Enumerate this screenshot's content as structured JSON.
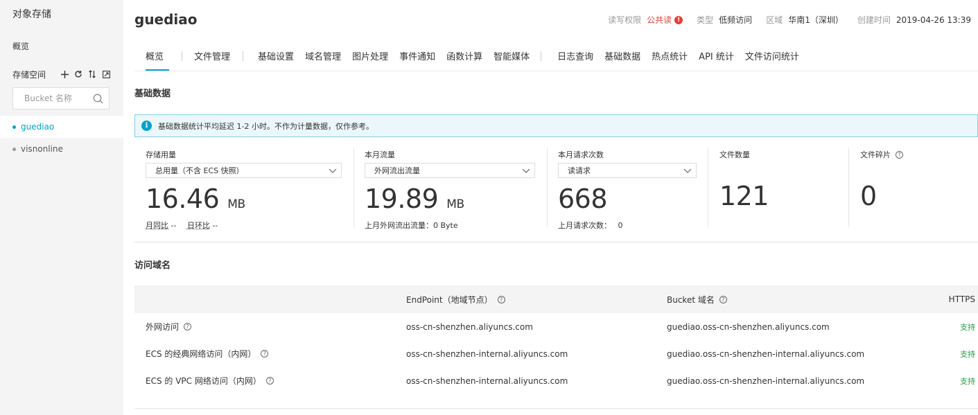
{
  "sidebar": {
    "title": "对象存储",
    "overview": "概览",
    "storage_space": "存储空间",
    "search_placeholder": "Bucket 名称",
    "buckets": [
      {
        "name": "guediao",
        "active": true
      },
      {
        "name": "visnonline",
        "active": false
      }
    ]
  },
  "header": {
    "bucket_name": "guediao",
    "acl_label": "读写权限",
    "acl_value": "公共读",
    "type_label": "类型",
    "type_value": "低频访问",
    "region_label": "区域",
    "region_value": "华南1（深圳）",
    "created_label": "创建时间",
    "created_value": "2019-04-26 13:39"
  },
  "tabs": [
    "概览",
    "文件管理",
    "基础设置",
    "域名管理",
    "图片处理",
    "事件通知",
    "函数计算",
    "智能媒体",
    "日志查询",
    "基础数据",
    "热点统计",
    "API 统计",
    "文件访问统计"
  ],
  "basic": {
    "title": "基础数据",
    "notice": "基础数据统计平均延迟 1-2 小时。不作为计量数据，仅作参考。",
    "stats": {
      "storage": {
        "label": "存储用量",
        "select": "总用量（不含 ECS 快照）",
        "value": "16.46",
        "unit": "MB",
        "yoy_label": "月同比",
        "yoy_value": "--",
        "mom_label": "日环比",
        "mom_value": "--"
      },
      "traffic": {
        "label": "本月流量",
        "select": "外网流出流量",
        "value": "19.89",
        "unit": "MB",
        "foot": "上月外网流出流量：0 Byte"
      },
      "requests": {
        "label": "本月请求次数",
        "select": "读请求",
        "value": "668",
        "foot_label": "上月请求次数：",
        "foot_value": "0"
      },
      "files": {
        "label": "文件数量",
        "value": "121"
      },
      "fragments": {
        "label": "文件碎片",
        "value": "0"
      }
    }
  },
  "domains": {
    "title": "访问域名",
    "headers": {
      "endpoint": "EndPoint（地域节点）",
      "bucket_domain": "Bucket 域名",
      "https": "HTTPS"
    },
    "rows": [
      {
        "name": "外网访问",
        "endpoint": "oss-cn-shenzhen.aliyuncs.com",
        "bucket_domain": "guediao.oss-cn-shenzhen.aliyuncs.com",
        "https": "支持"
      },
      {
        "name": "ECS 的经典网络访问（内网）",
        "endpoint": "oss-cn-shenzhen-internal.aliyuncs.com",
        "bucket_domain": "guediao.oss-cn-shenzhen-internal.aliyuncs.com",
        "https": "支持"
      },
      {
        "name": "ECS 的 VPC 网络访问（内网）",
        "endpoint": "oss-cn-shenzhen-internal.aliyuncs.com",
        "bucket_domain": "guediao.oss-cn-shenzhen-internal.aliyuncs.com",
        "https": "支持"
      }
    ]
  },
  "colors": {
    "accent": "#00a2ca",
    "danger": "#e5403a",
    "success": "#1e9e3c"
  }
}
